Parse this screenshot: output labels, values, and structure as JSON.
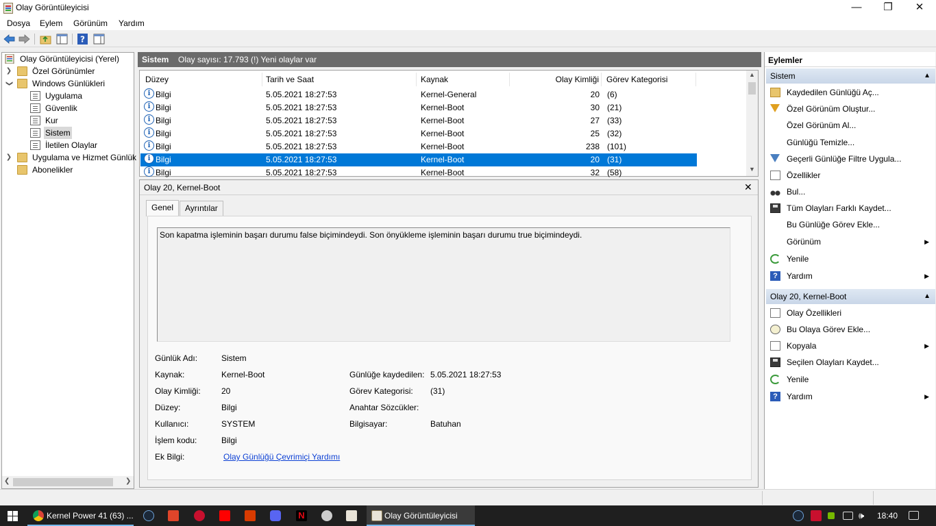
{
  "window": {
    "title": "Olay Görüntüleyicisi"
  },
  "menu": [
    "Dosya",
    "Eylem",
    "Görünüm",
    "Yardım"
  ],
  "tree": {
    "items": [
      {
        "label": "Olay Görüntüleyicisi (Yerel)"
      },
      {
        "label": "Özel Görünümler"
      },
      {
        "label": "Windows Günlükleri"
      },
      {
        "label": "Uygulama"
      },
      {
        "label": "Güvenlik"
      },
      {
        "label": "Kur"
      },
      {
        "label": "Sistem"
      },
      {
        "label": "İletilen Olaylar"
      },
      {
        "label": "Uygulama ve Hizmet Günlük"
      },
      {
        "label": "Abonelikler"
      }
    ]
  },
  "log_header": {
    "title": "Sistem",
    "count": "Olay sayısı: 17.793 (!) Yeni olaylar var"
  },
  "event_list": {
    "columns": [
      "Düzey",
      "Tarih ve Saat",
      "Kaynak",
      "Olay Kimliği",
      "Görev Kategorisi"
    ],
    "rows": [
      {
        "level": "Bilgi",
        "datetime": "5.05.2021 18:27:53",
        "source": "Kernel-General",
        "id": "20",
        "category": "(6)"
      },
      {
        "level": "Bilgi",
        "datetime": "5.05.2021 18:27:53",
        "source": "Kernel-Boot",
        "id": "30",
        "category": "(21)"
      },
      {
        "level": "Bilgi",
        "datetime": "5.05.2021 18:27:53",
        "source": "Kernel-Boot",
        "id": "27",
        "category": "(33)"
      },
      {
        "level": "Bilgi",
        "datetime": "5.05.2021 18:27:53",
        "source": "Kernel-Boot",
        "id": "25",
        "category": "(32)"
      },
      {
        "level": "Bilgi",
        "datetime": "5.05.2021 18:27:53",
        "source": "Kernel-Boot",
        "id": "238",
        "category": "(101)"
      },
      {
        "level": "Bilgi",
        "datetime": "5.05.2021 18:27:53",
        "source": "Kernel-Boot",
        "id": "20",
        "category": "(31)"
      },
      {
        "level": "Bilgi",
        "datetime": "5.05.2021 18:27:53",
        "source": "Kernel-Boot",
        "id": "32",
        "category": "(58)"
      }
    ]
  },
  "detail": {
    "title": "Olay 20, Kernel-Boot",
    "close": "✕",
    "tabs": [
      "Genel",
      "Ayrıntılar"
    ],
    "description": "Son kapatma işleminin başarı durumu false biçimindeydi. Son önyükleme işleminin başarı durumu true biçimindeydi.",
    "fields": {
      "log_name_label": "Günlük Adı:",
      "log_name": "Sistem",
      "source_label": "Kaynak:",
      "source": "Kernel-Boot",
      "logged_label": "Günlüğe kaydedilen:",
      "logged": "5.05.2021 18:27:53",
      "event_id_label": "Olay Kimliği:",
      "event_id": "20",
      "task_label": "Görev Kategorisi:",
      "task": "(31)",
      "level_label": "Düzey:",
      "level": "Bilgi",
      "keywords_label": "Anahtar Sözcükler:",
      "keywords": "",
      "user_label": "Kullanıcı:",
      "user": "SYSTEM",
      "computer_label": "Bilgisayar:",
      "computer": "Batuhan",
      "opcode_label": "İşlem kodu:",
      "opcode": "Bilgi",
      "more_label": "Ek Bilgi:",
      "more_link": "Olay Günlüğü Çevrimiçi Yardımı"
    }
  },
  "actions": {
    "title": "Eylemler",
    "section1": "Sistem",
    "items1": [
      {
        "label": "Kaydedilen Günlüğü Aç...",
        "icon": "open-log-icon"
      },
      {
        "label": "Özel Görünüm Oluştur...",
        "icon": "filter-create-icon"
      },
      {
        "label": "Özel Görünüm Al...",
        "icon": ""
      },
      {
        "label": "Günlüğü Temizle...",
        "icon": ""
      },
      {
        "label": "Geçerli Günlüğe Filtre Uygula...",
        "icon": "filter-icon"
      },
      {
        "label": "Özellikler",
        "icon": "properties-icon"
      },
      {
        "label": "Bul...",
        "icon": "binoculars-icon"
      },
      {
        "label": "Tüm Olayları Farklı Kaydet...",
        "icon": "save-icon"
      },
      {
        "label": "Bu Günlüğe Görev Ekle...",
        "icon": ""
      },
      {
        "label": "Görünüm",
        "icon": "",
        "submenu": true
      },
      {
        "label": "Yenile",
        "icon": "refresh-icon"
      },
      {
        "label": "Yardım",
        "icon": "help-icon",
        "submenu": true
      }
    ],
    "section2": "Olay 20, Kernel-Boot",
    "items2": [
      {
        "label": "Olay Özellikleri",
        "icon": "properties-icon"
      },
      {
        "label": "Bu Olaya Görev Ekle...",
        "icon": "task-clock-icon"
      },
      {
        "label": "Kopyala",
        "icon": "copy-icon",
        "submenu": true
      },
      {
        "label": "Seçilen Olayları Kaydet...",
        "icon": "save-icon"
      },
      {
        "label": "Yenile",
        "icon": "refresh-icon"
      },
      {
        "label": "Yardım",
        "icon": "help-icon",
        "submenu": true
      }
    ]
  },
  "taskbar": {
    "chrome_window": "Kernel Power 41 (63) ...",
    "active_window": "Olay Görüntüleyicisi",
    "clock": "18:40"
  },
  "colors": {
    "selection": "#0078d7",
    "header_gray": "#6b6b6b",
    "link": "#0b3fd4"
  }
}
